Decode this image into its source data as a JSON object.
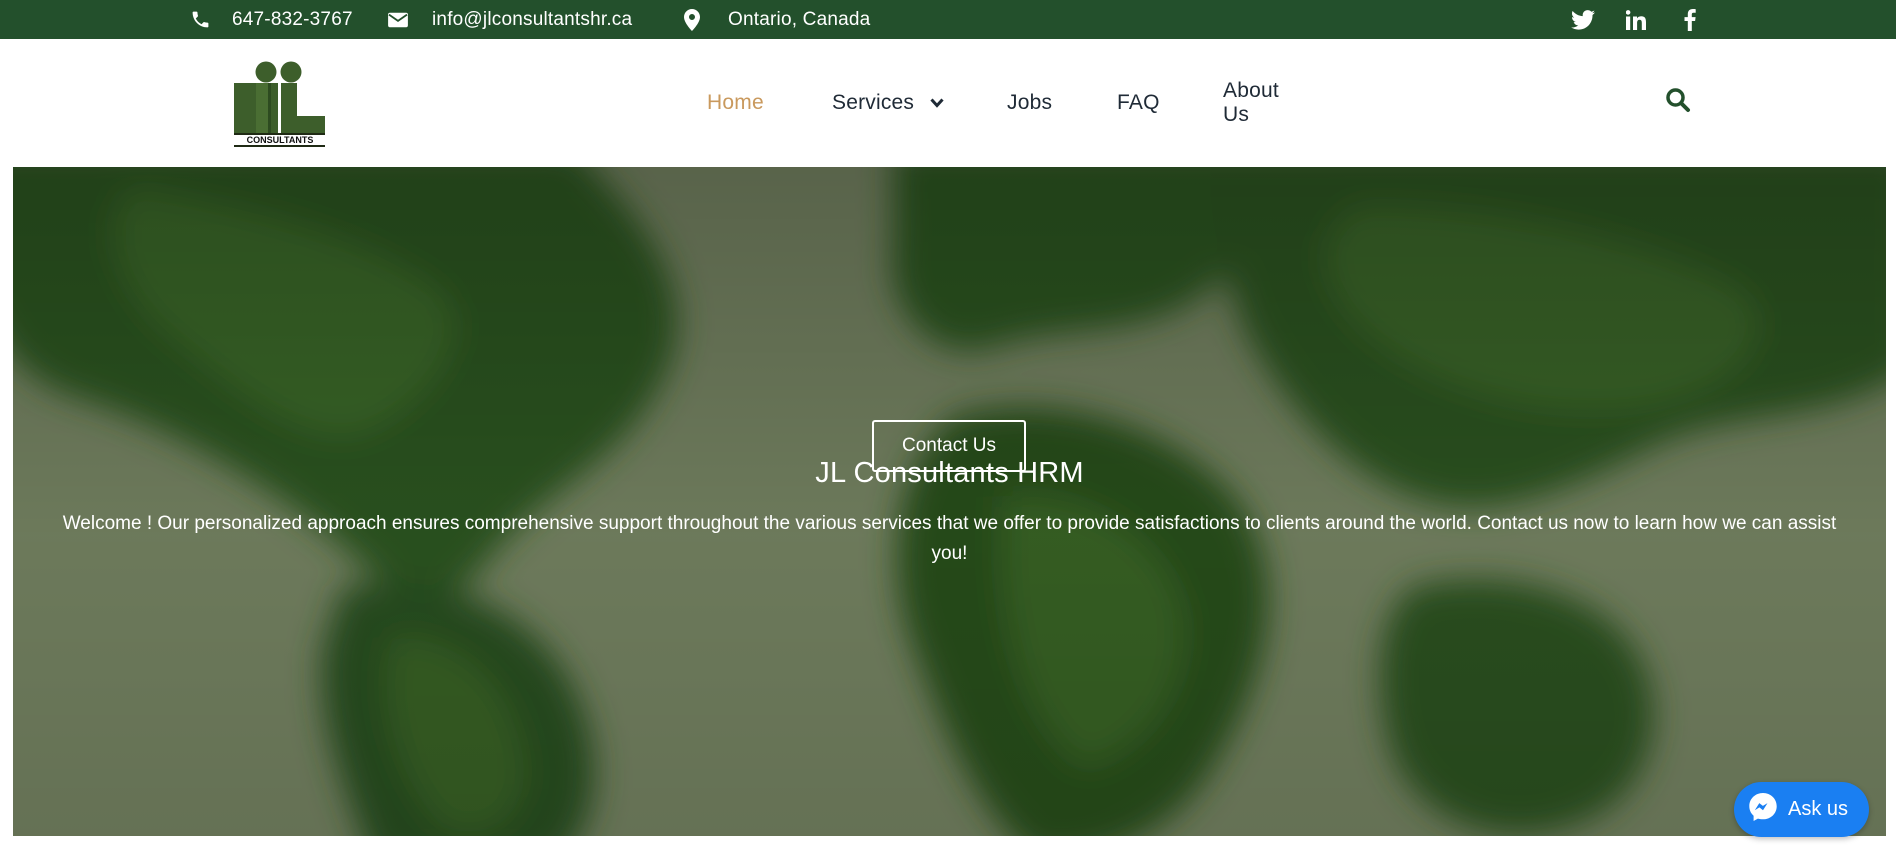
{
  "topbar": {
    "phone": "647-832-3767",
    "email": "info@jlconsultantshr.ca",
    "location": "Ontario, Canada",
    "icons": [
      "phone-icon",
      "envelope-icon",
      "map-pin-icon"
    ],
    "social": [
      "twitter-icon",
      "linkedin-icon",
      "facebook-icon"
    ],
    "background_color": "#23502c"
  },
  "logo": {
    "text": "CONSULTANTS",
    "brand_color": "#3d5e2b"
  },
  "nav": {
    "items": [
      {
        "label": "Home",
        "active": true
      },
      {
        "label": "Services",
        "has_dropdown": true
      },
      {
        "label": "Jobs"
      },
      {
        "label": "FAQ"
      },
      {
        "label": "About Us"
      }
    ],
    "active_color": "#c9995d",
    "search_icon": "search-icon"
  },
  "hero": {
    "title": "JL Consultants HRM",
    "text": "Welcome ! Our personalized approach ensures comprehensive support throughout the various services that we offer to provide satisfactions to clients around the world. Contact us now to learn how we can assist you!",
    "button_label": "Contact Us"
  },
  "chat": {
    "label": "Ask us",
    "icon": "messenger-icon",
    "color": "#1a7ff2"
  }
}
